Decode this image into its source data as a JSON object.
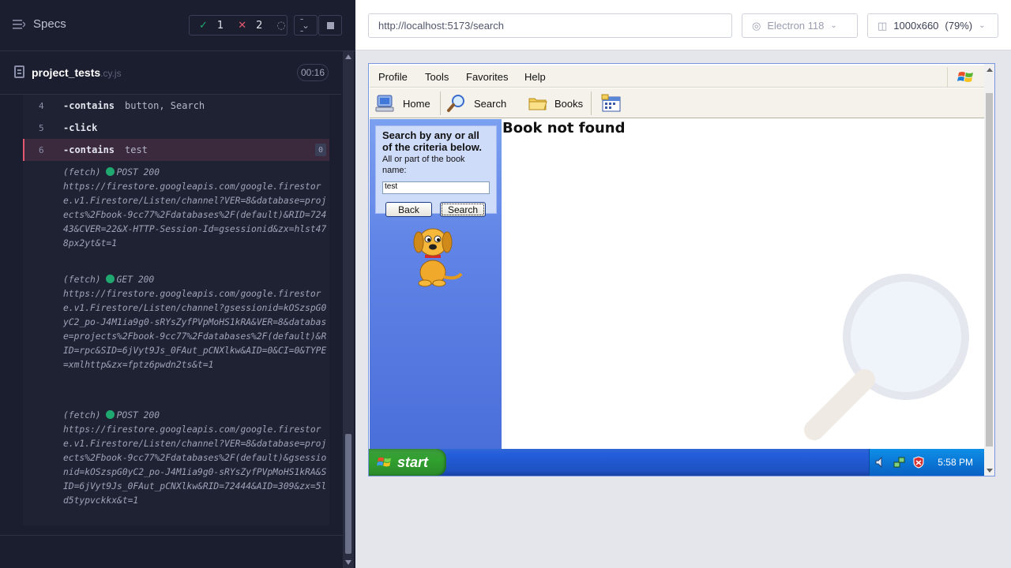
{
  "specs": {
    "title": "Specs"
  },
  "stats": {
    "passed": "1",
    "failed": "2",
    "pending": "--"
  },
  "spec_file": {
    "name": "project_tests",
    "ext": ".cy.js",
    "duration": "00:16"
  },
  "commands": [
    {
      "num": "4",
      "name": "-contains",
      "arg": "button, Search"
    },
    {
      "num": "5",
      "name": "-click",
      "arg": ""
    },
    {
      "num": "6",
      "name": "-contains",
      "arg": "test",
      "badge": "0"
    }
  ],
  "fetch_logs": [
    {
      "label": "(fetch)",
      "method": "POST 200",
      "url": "https://firestore.googleapis.com/google.firestore.v1.Firestore/Listen/channel?VER=8&database=projects%2Fbook-9cc77%2Fdatabases%2F(default)&RID=72443&CVER=22&X-HTTP-Session-Id=gsessionid&zx=hlst478px2yt&t=1"
    },
    {
      "label": "(fetch)",
      "method": "GET 200",
      "url": "https://firestore.googleapis.com/google.firestore.v1.Firestore/Listen/channel?gsessionid=kOSzspG0yC2_po-J4M1ia9g0-sRYsZyfPVpMoHS1kRA&VER=8&database=projects%2Fbook-9cc77%2Fdatabases%2F(default)&RID=rpc&SID=6jVyt9Js_0FAut_pCNXlkw&AID=0&CI=0&TYPE=xmlhttp&zx=fptz6pwdn2ts&t=1"
    },
    {
      "label": "(fetch)",
      "method": "POST 200",
      "url": "https://firestore.googleapis.com/google.firestore.v1.Firestore/Listen/channel?VER=8&database=projects%2Fbook-9cc77%2Fdatabases%2F(default)&gsessionid=kOSzspG0yC2_po-J4M1ia9g0-sRYsZyfPVpMoHS1kRA&SID=6jVyt9Js_0FAut_pCNXlkw&RID=72444&AID=309&zx=5ld5typvckkx&t=1"
    }
  ],
  "aut": {
    "url": "http://localhost:5173/search",
    "browser": "Electron 118",
    "viewport": "1000x660",
    "scale": "(79%)"
  },
  "xp": {
    "menu": [
      "Profile",
      "Tools",
      "Favorites",
      "Help"
    ],
    "toolbar": {
      "home": "Home",
      "search": "Search",
      "books": "Books"
    },
    "search_card": {
      "title": "Search by any or all of the criteria below.",
      "subtitle": "All or part of the book name:",
      "input_value": "test",
      "back_label": "Back",
      "search_label": "Search"
    },
    "result": "Book not found",
    "taskbar": {
      "start": "start",
      "clock": "5:58 PM"
    }
  },
  "colors": {
    "pass": "#1fa971",
    "fail": "#e45770",
    "xp_blue": "#245edb"
  }
}
